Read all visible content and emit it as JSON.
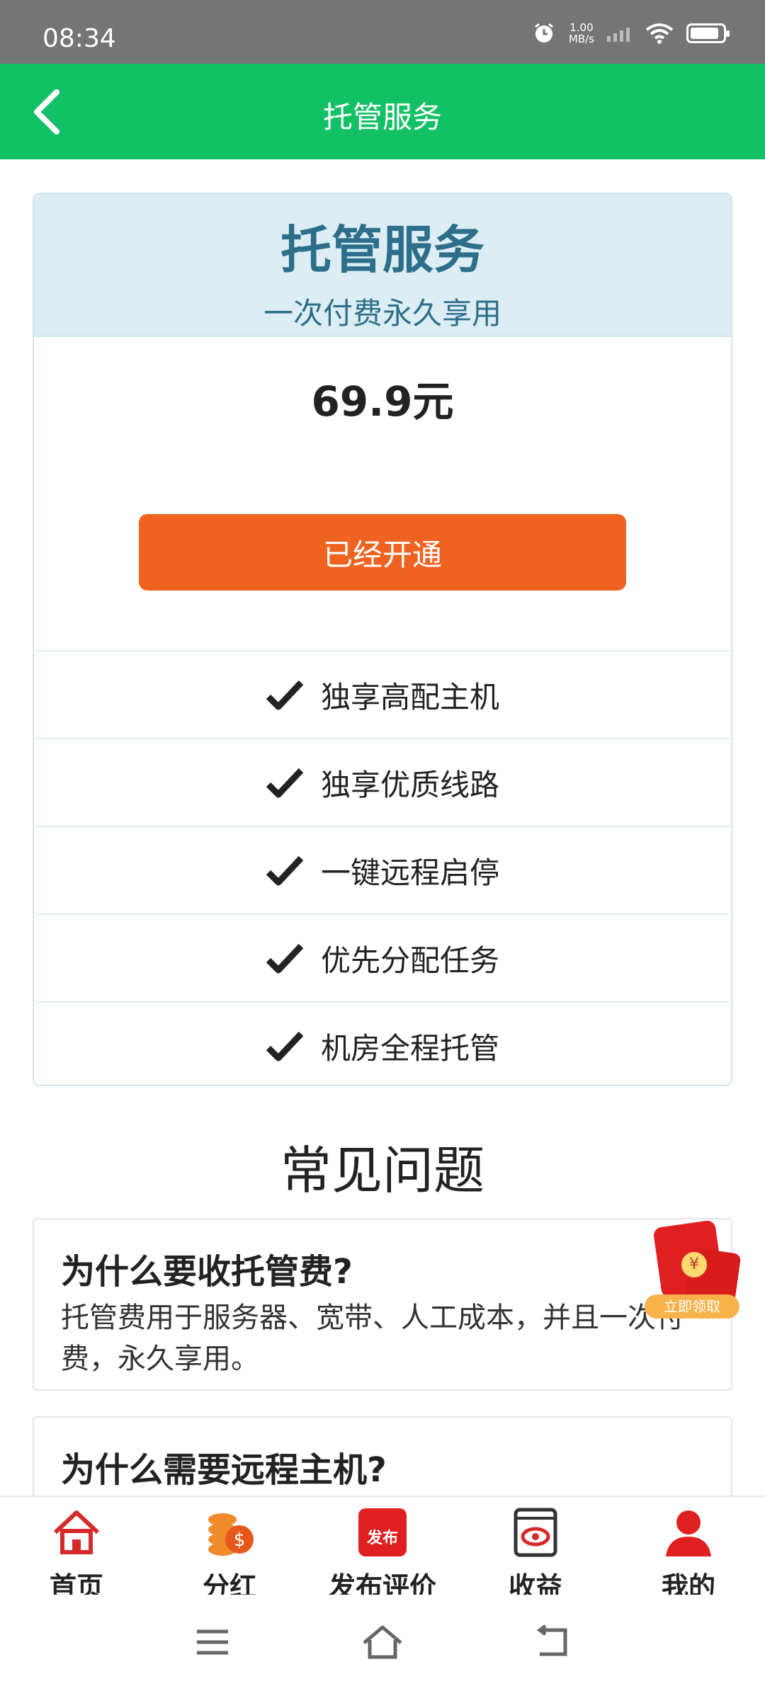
{
  "status_bar": {
    "time": "08:34",
    "speed_value": "1.00",
    "speed_unit": "MB/s"
  },
  "app_bar": {
    "title": "托管服务",
    "back_icon": "chevron-left-icon"
  },
  "plan": {
    "title": "托管服务",
    "subtitle": "一次付费永久享用",
    "price": "69.9元",
    "button_label": "已经开通",
    "features": [
      "独享高配主机",
      "独享优质线路",
      "一键远程启停",
      "优先分配任务",
      "机房全程托管"
    ]
  },
  "faq": {
    "title": "常见问题",
    "items": [
      {
        "question": "为什么要收托管费?",
        "answer": "托管费用于服务器、宽带、人工成本，并且一次付费，永久享用。"
      },
      {
        "question": "为什么需要远程主机?",
        "answer": ""
      }
    ]
  },
  "promo": {
    "label": "立即领取"
  },
  "bottom_nav": [
    {
      "label": "首页",
      "icon": "home-icon"
    },
    {
      "label": "分红",
      "icon": "coins-icon"
    },
    {
      "label": "发布评价",
      "icon": "publish-icon",
      "icon_text": "发布"
    },
    {
      "label": "收益",
      "icon": "earnings-icon"
    },
    {
      "label": "我的",
      "icon": "profile-icon"
    }
  ],
  "colors": {
    "app_bar": "#12c165",
    "button": "#f0621f",
    "accent_red": "#e02020"
  }
}
